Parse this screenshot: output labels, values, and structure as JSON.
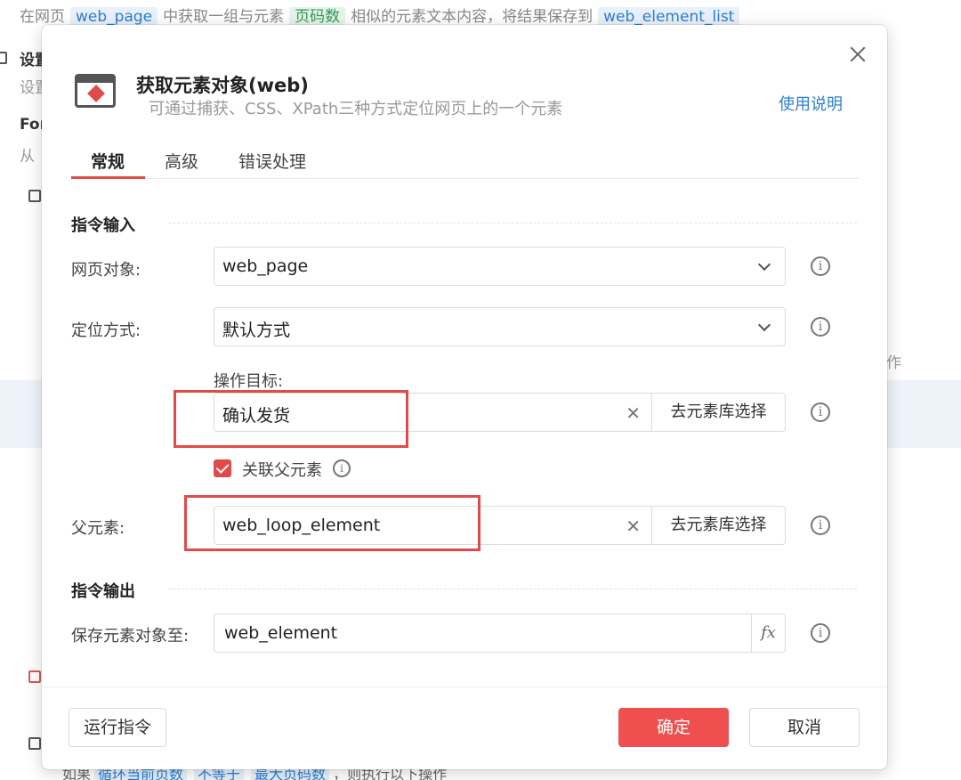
{
  "background": {
    "instruction": {
      "prefix": "在网页",
      "page_var": "web_page",
      "mid1": "中获取一组与元素",
      "element_var": "页码数",
      "mid2": "相似的元素文本内容，将结果保存到",
      "list_var": "web_element_list"
    },
    "fragments": {
      "settings_title": "设置",
      "settings_sub": "设置",
      "for_title": "For",
      "for_sub": "从",
      "op_fragment": "作"
    },
    "bottom": {
      "prefix": "如果",
      "var1": "循环当前页数",
      "op": "不等于",
      "var2": "最大页码数",
      "suffix": "，则执行以下操作"
    }
  },
  "dialog": {
    "title": "获取元素对象(web)",
    "subtitle": "可通过捕获、CSS、XPath三种方式定位网页上的一个元素",
    "help_link": "使用说明",
    "tabs": [
      {
        "label": "常规",
        "active": true
      },
      {
        "label": "高级",
        "active": false
      },
      {
        "label": "错误处理",
        "active": false
      }
    ],
    "input_section": "指令输入",
    "web_page_label": "网页对象:",
    "web_page_value": "web_page",
    "locate_label": "定位方式:",
    "locate_value": "默认方式",
    "target_label": "操作目标:",
    "target_value": "确认发货",
    "library_button": "去元素库选择",
    "link_parent_label": "关联父元素",
    "link_parent_checked": true,
    "parent_label": "父元素:",
    "parent_value": "web_loop_element",
    "output_section": "指令输出",
    "save_label": "保存元素对象至:",
    "save_value": "web_element",
    "fx_label": "fx",
    "run_button": "运行指令",
    "confirm_button": "确定",
    "cancel_button": "取消",
    "accent_color": "#e24a4a",
    "link_color": "#2d7fd3"
  }
}
